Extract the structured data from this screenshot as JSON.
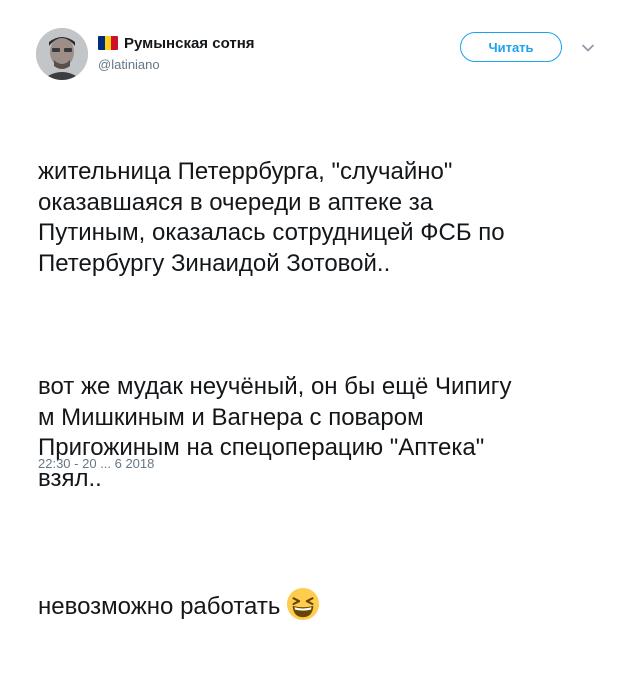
{
  "tweet": {
    "author": {
      "display_name": "Румынская сотня",
      "handle": "@latiniano",
      "flag_colors": [
        "#002b7f",
        "#fcd116",
        "#ce1126"
      ]
    },
    "follow_label": "Читать",
    "paragraphs": [
      "жительница Петеррбурга, \"случайно\"\nоказавшаяся в очереди в аптеке за\nПутиным, оказалась сотрудницей ФСБ по\nПетербургу Зинаидой Зотовой..",
      "вот же мудак неучёный, он бы ещё Чипигу\nм Мишкиным и Вагнера с поваром\nПригожиным на спецоперацию \"Аптека\"\nвзял..",
      "невозможно работать"
    ],
    "emoji": "grinning-squinting-face",
    "timestamp": "22:30 - 20 ... 6 2018"
  },
  "colors": {
    "accent": "#1da1f2",
    "text": "#14171a",
    "secondary_text": "#657786"
  }
}
